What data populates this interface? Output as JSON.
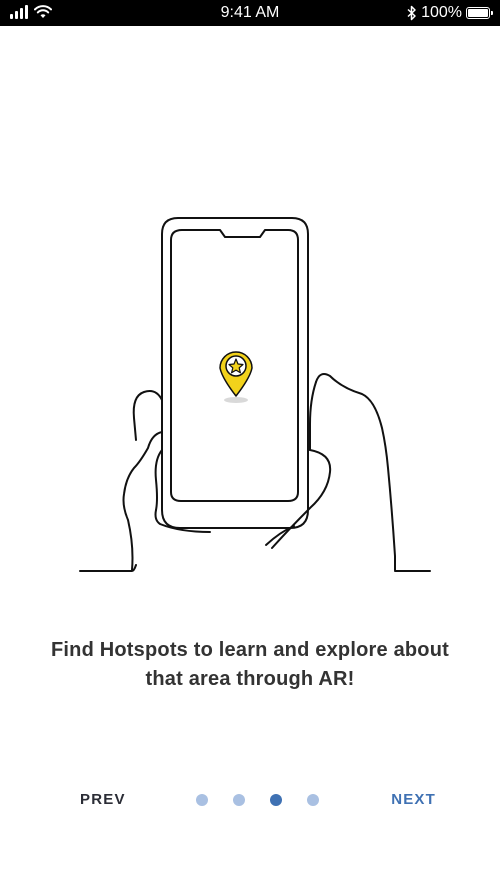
{
  "status_bar": {
    "time": "9:41 AM",
    "battery_text": "100%",
    "icons": [
      "signal-icon",
      "wifi-icon",
      "bluetooth-icon",
      "battery-icon"
    ]
  },
  "illustration": {
    "description_icons": [
      "phone-in-hands-illustration",
      "location-pin-star-icon"
    ],
    "pin_color": "#f2d21b"
  },
  "caption": {
    "text": "Find Hotspots to learn and explore about that area through AR!"
  },
  "navigation": {
    "prev_label": "PREV",
    "next_label": "NEXT",
    "page_count": 4,
    "current_page": 3
  },
  "colors": {
    "accent": "#3f71b3",
    "dot_inactive": "#a9c0e2",
    "text_dark": "#333333"
  }
}
